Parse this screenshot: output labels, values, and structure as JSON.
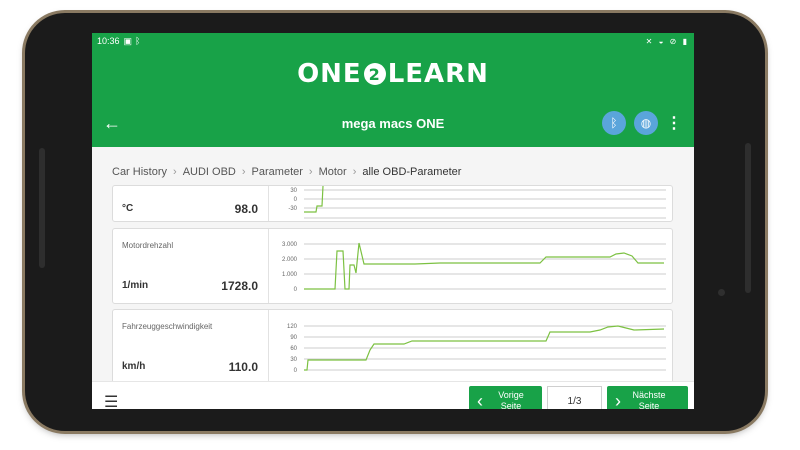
{
  "status_bar": {
    "time": "10:36",
    "left_icons": [
      "image-icon",
      "bluetooth-icon"
    ],
    "right_icons": [
      "mute-icon",
      "wifi-icon",
      "dnd-icon",
      "battery-icon"
    ]
  },
  "logo": {
    "part1": "ONE",
    "middle": "2",
    "part2": "LEARN"
  },
  "appbar": {
    "title": "mega macs ONE"
  },
  "breadcrumb": [
    "Car History",
    "AUDI OBD",
    "Parameter",
    "Motor",
    "alle OBD-Parameter"
  ],
  "parameters": [
    {
      "name": "",
      "unit": "°C",
      "value": "98.0",
      "ticks": [
        "30",
        "0",
        "-30"
      ]
    },
    {
      "name": "Motordrehzahl",
      "unit": "1/min",
      "value": "1728.0",
      "ticks": [
        "3.000",
        "2.000",
        "1.000",
        "0"
      ]
    },
    {
      "name": "Fahrzeuggeschwindigkeit",
      "unit": "km/h",
      "value": "110.0",
      "ticks": [
        "120",
        "90",
        "60",
        "30",
        "0"
      ]
    }
  ],
  "nav": {
    "prev_label": "Vorige Seite",
    "next_label": "Nächste Seite",
    "page_indicator": "1/3"
  },
  "colors": {
    "brand_green": "#18a248",
    "line_green": "#7cc142",
    "icon_blue": "#5aa5db"
  },
  "icons": {
    "back": "arrow-left-icon",
    "bluetooth": "bluetooth-icon",
    "globe": "globe-icon",
    "more": "more-vert-icon",
    "menu": "hamburger-menu-icon",
    "prev": "chevron-left-icon",
    "next": "chevron-right-icon"
  }
}
